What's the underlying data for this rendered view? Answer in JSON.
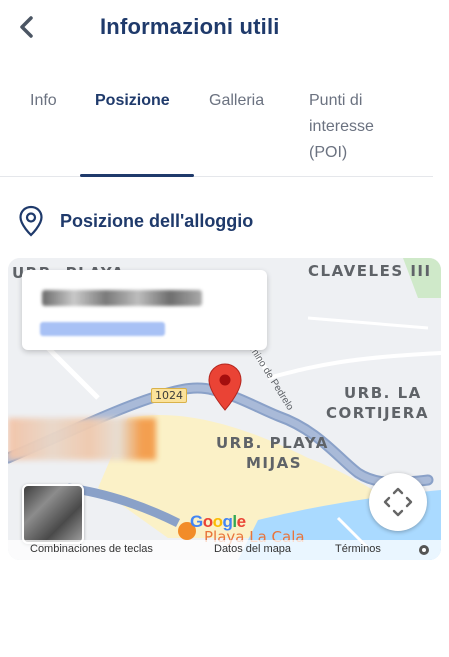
{
  "header": {
    "title": "Informazioni utili",
    "back_icon": "chevron-left-icon"
  },
  "tabs": [
    {
      "label": "Info",
      "active": false
    },
    {
      "label": "Posizione",
      "active": true
    },
    {
      "label": "Galleria",
      "active": false
    },
    {
      "label_lines": [
        "Punti di",
        "interesse",
        "(POI)"
      ],
      "active": false
    }
  ],
  "section": {
    "title": "Posizione dell'alloggio",
    "icon": "location-pin-icon"
  },
  "map": {
    "labels": {
      "urb_playa_top": "URB. PLAYA",
      "claveles": "CLAVELES III",
      "urb_la": "URB. LA",
      "cortijera": "CORTIJERA",
      "urb_playa": "URB. PLAYA",
      "mijas": "MIJAS",
      "road": "1024",
      "street": "Camino de Pedrelo",
      "poi": "Playa La Cala",
      "google": "Google"
    },
    "attribution": {
      "shortcuts": "Combinaciones de teclas",
      "data": "Datos del mapa",
      "terms": "Términos"
    },
    "colors": {
      "accent": "#1f3a6b",
      "pin": "#ea4335",
      "road": "#8aa1c8",
      "beach": "#fbf1c7",
      "sea": "#aadaff",
      "land": "#eef0f3"
    }
  }
}
